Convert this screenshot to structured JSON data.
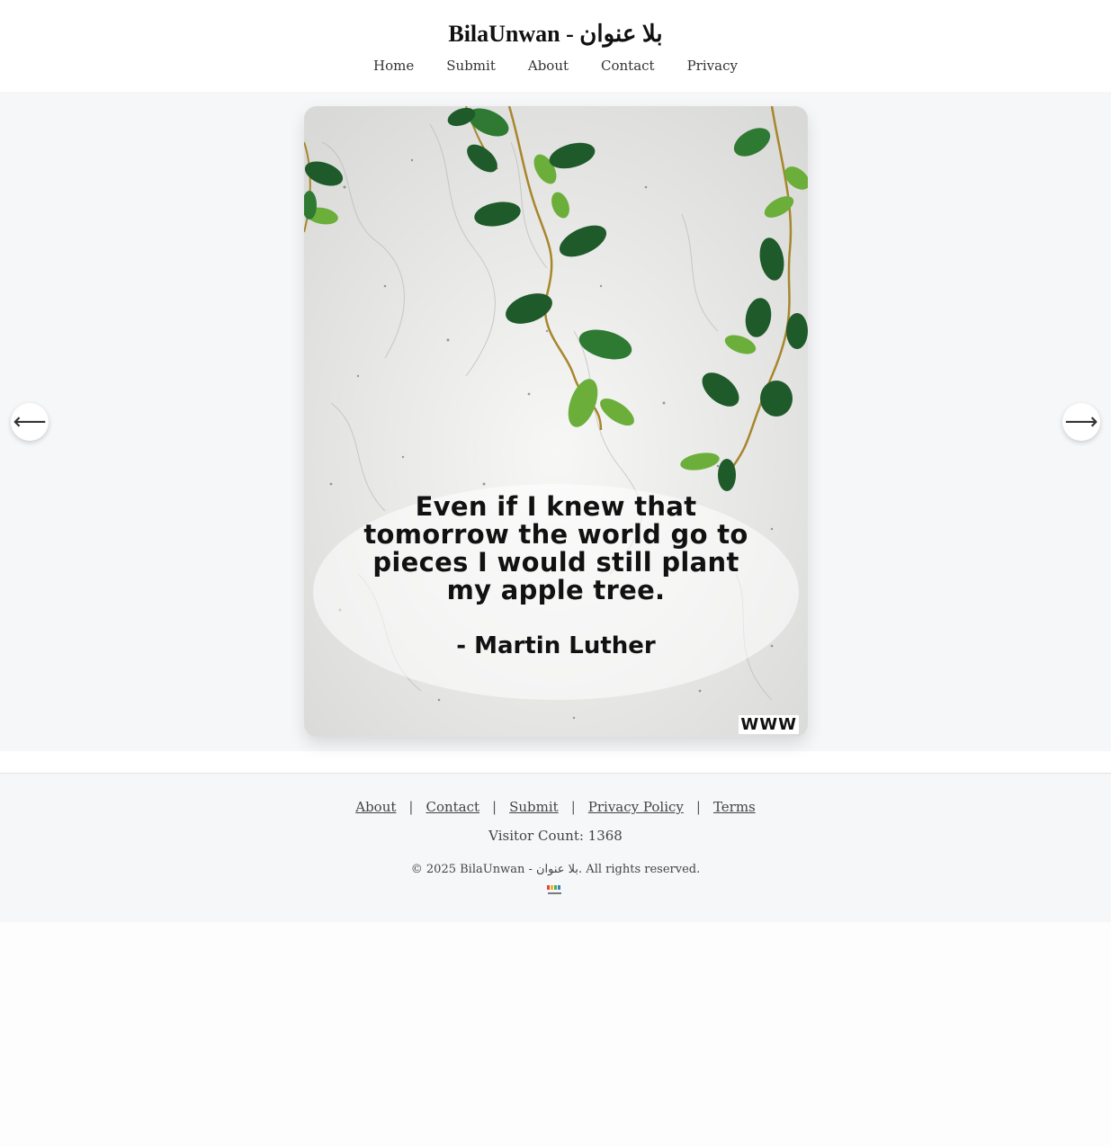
{
  "header": {
    "site_title": "BilaUnwan - بلا عنوان",
    "nav": [
      {
        "label": "Home"
      },
      {
        "label": "Submit"
      },
      {
        "label": "About"
      },
      {
        "label": "Contact"
      },
      {
        "label": "Privacy"
      }
    ]
  },
  "gallery": {
    "prev_arrow": "⟵",
    "next_arrow": "⟶",
    "quote": {
      "line1": "Even if I knew that",
      "line2": "tomorrow the world go to",
      "line3": "pieces I would still plant",
      "line4": "my apple tree.",
      "author": "- Martin Luther",
      "watermark": "WWW"
    },
    "colors": {
      "leaf_dark": "#1f5a2a",
      "leaf_light": "#6cae3a",
      "stem": "#a7862c"
    }
  },
  "footer": {
    "links": [
      {
        "label": "About"
      },
      {
        "label": "Contact"
      },
      {
        "label": "Submit"
      },
      {
        "label": "Privacy Policy"
      },
      {
        "label": "Terms"
      }
    ],
    "separator": "|",
    "visitor_count": "Visitor Count: 1368",
    "copyright": "© 2025 BilaUnwan - بلا عنوان. All rights reserved.",
    "logo_icon": "bilaunwan-logo-icon"
  }
}
